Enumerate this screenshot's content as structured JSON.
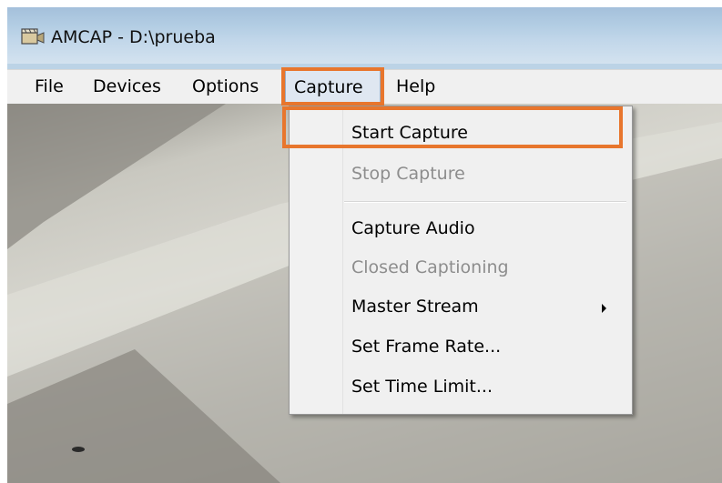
{
  "window": {
    "title": "AMCAP - D:\\prueba"
  },
  "menubar": {
    "items": [
      {
        "label": "File"
      },
      {
        "label": "Devices"
      },
      {
        "label": "Options"
      },
      {
        "label": "Capture"
      },
      {
        "label": "Help"
      }
    ],
    "open_menu": "Capture"
  },
  "capture_menu": {
    "start_capture": "Start Capture",
    "stop_capture": "Stop Capture",
    "capture_audio": "Capture Audio",
    "closed_captioning": "Closed Captioning",
    "master_stream": "Master Stream",
    "set_frame_rate": "Set Frame Rate...",
    "set_time_limit": "Set Time Limit..."
  },
  "colors": {
    "highlight": "#e8762d",
    "menu_bg": "#f0f0f0",
    "disabled_text": "#8d8d8d"
  },
  "icons": {
    "app": "camera-clapper-icon",
    "submenu": "chevron-right-icon"
  }
}
